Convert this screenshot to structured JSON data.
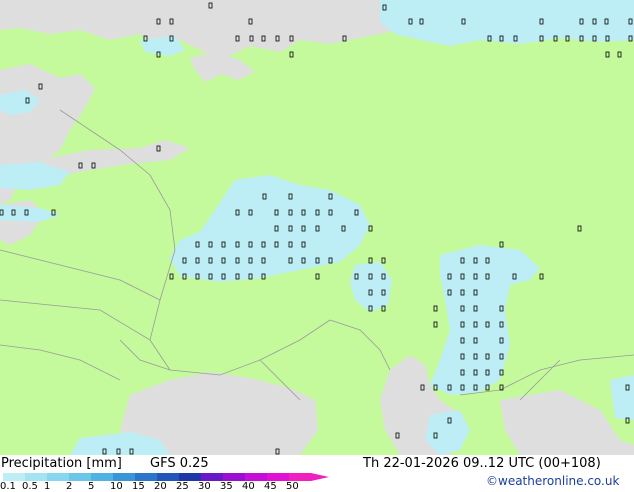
{
  "map": {
    "colors": {
      "land": "#c4fa9c",
      "sea": "#dedede",
      "precip_light": "#bdeef5",
      "border": "#9a9a9a"
    }
  },
  "footer": {
    "product_label": "Precipitation [mm]",
    "model_label": "GFS 0.25",
    "valid_time": "Th 22-01-2026 09..12 UTC (00+108)",
    "credit": "©weatheronline.co.uk",
    "scale_ticks": [
      "0.1",
      "0.5",
      "1",
      "2",
      "5",
      "10",
      "15",
      "20",
      "25",
      "30",
      "35",
      "40",
      "45",
      "50"
    ],
    "scale_colors": [
      "#bdeef5",
      "#a3e3f2",
      "#88d6ef",
      "#6cc6ea",
      "#4fb2e3",
      "#3a95d8",
      "#2b76c8",
      "#2256b7",
      "#1e39a5",
      "#6a17c7",
      "#9a10d3",
      "#c40fd6",
      "#e011d0",
      "#f020c0"
    ]
  }
}
